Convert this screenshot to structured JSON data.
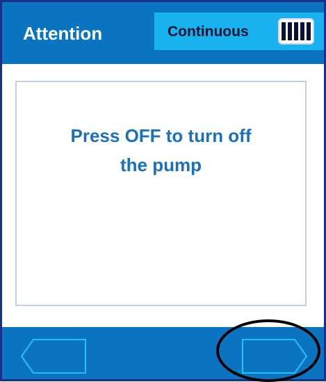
{
  "header": {
    "title": "Attention",
    "mode_label": "Continuous",
    "battery_level_fraction": 1.0
  },
  "main": {
    "message": "Press OFF to turn off\nthe pump"
  },
  "footer": {
    "left_button_icon": "arrow-left-outline-icon",
    "right_button_icon": "arrow-right-outline-icon"
  },
  "colors": {
    "frame_blue": "#0a74c0",
    "mode_box_blue": "#18b2ee",
    "message_text_blue": "#1a70c0",
    "border_dark_blue": "#1a2f8a",
    "nav_outline": "#28c0f0"
  }
}
